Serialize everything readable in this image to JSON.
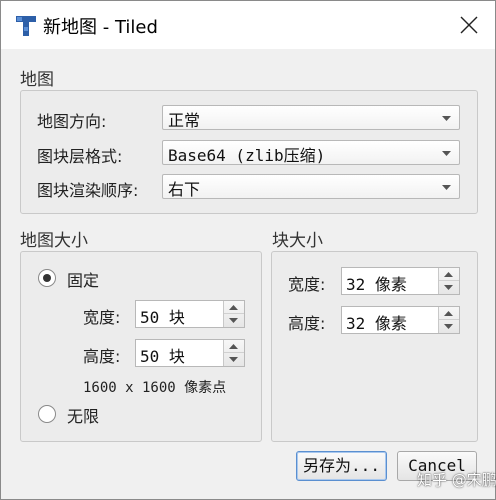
{
  "window": {
    "title": "新地图 - Tiled",
    "icons": {
      "app": "tiled-app-icon",
      "close": "close-icon"
    }
  },
  "map_section": {
    "title": "地图",
    "orientation": {
      "label": "地图方向:",
      "value": "正常"
    },
    "layer_format": {
      "label": "图块层格式:",
      "value": "Base64 (zlib压缩)"
    },
    "render_order": {
      "label": "图块渲染顺序:",
      "value": "右下"
    }
  },
  "map_size": {
    "title": "地图大小",
    "fixed": {
      "label": "固定",
      "selected": true
    },
    "width": {
      "label": "宽度:",
      "value": "50 块"
    },
    "height": {
      "label": "高度:",
      "value": "50 块"
    },
    "pixel_info": "1600 x 1600 像素点",
    "infinite": {
      "label": "无限",
      "selected": false
    }
  },
  "tile_size": {
    "title": "块大小",
    "width": {
      "label": "宽度:",
      "value": "32 像素"
    },
    "height": {
      "label": "高度:",
      "value": "32 像素"
    }
  },
  "buttons": {
    "save_as": "另存为...",
    "cancel": "Cancel"
  },
  "watermark": "知乎 @宋鹏",
  "colors": {
    "focus_border": "#5a8fd0",
    "dialog_bg": "#f0f0f0",
    "titlebar_bg": "#ffffff"
  }
}
